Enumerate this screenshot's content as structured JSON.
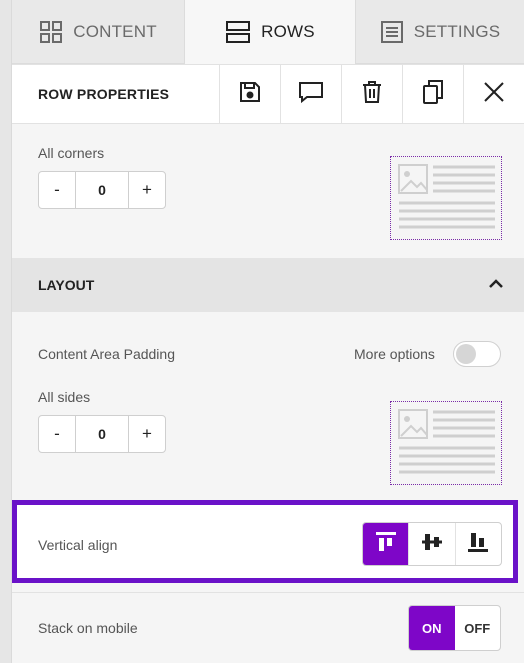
{
  "tabs": [
    {
      "label": "CONTENT",
      "icon": "grid-icon",
      "active": false
    },
    {
      "label": "ROWS",
      "icon": "rows-icon",
      "active": true
    },
    {
      "label": "SETTINGS",
      "icon": "settings-list-icon",
      "active": false
    }
  ],
  "row_properties": {
    "title": "ROW PROPERTIES",
    "tools": [
      "save-icon",
      "comment-icon",
      "trash-icon",
      "duplicate-icon",
      "close-icon"
    ]
  },
  "corners": {
    "label": "All corners",
    "value": "0",
    "minus": "-",
    "plus": "+"
  },
  "layout": {
    "title": "LAYOUT",
    "content_area_padding_label": "Content Area Padding",
    "more_options_label": "More options",
    "more_options_on": false,
    "all_sides_label": "All sides",
    "all_sides_value": "0",
    "minus": "-",
    "plus": "+"
  },
  "vertical_align": {
    "label": "Vertical align",
    "options": [
      "align-top-icon",
      "align-middle-icon",
      "align-bottom-icon"
    ],
    "selected": "align-top-icon"
  },
  "stack_on_mobile": {
    "label": "Stack on mobile",
    "on_label": "ON",
    "off_label": "OFF",
    "selected": "ON"
  },
  "colors": {
    "accent": "#7e06c8",
    "highlight_border": "#6a12c8"
  }
}
